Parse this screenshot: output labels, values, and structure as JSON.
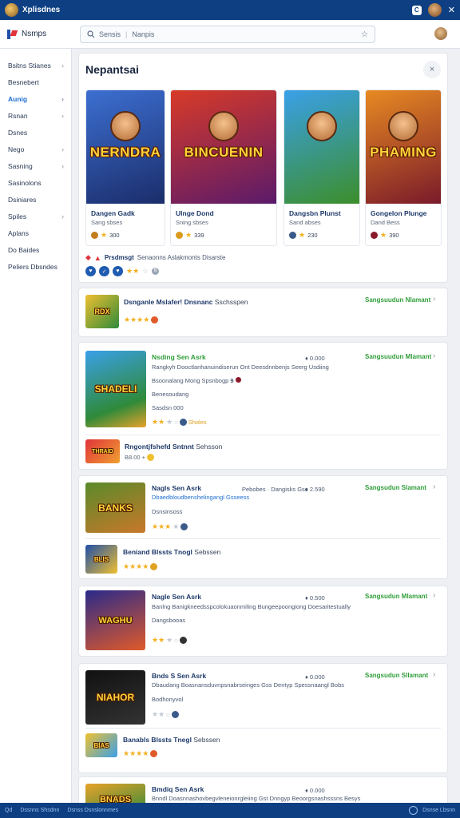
{
  "topbar": {
    "title": "Xplisdnes",
    "badge": "C",
    "close": "✕"
  },
  "header": {
    "brand": "Nsmps",
    "search_left": "Sensis",
    "search_right": "Nanpis",
    "pin": "☆"
  },
  "sidebar": {
    "items": [
      {
        "label": "Bsitns Stianes",
        "chev": true
      },
      {
        "label": "Besnebert",
        "chev": false
      },
      {
        "label": "Aunig",
        "chev": true,
        "active": true
      },
      {
        "label": "Rsnan",
        "chev": true
      },
      {
        "label": "Dsnes",
        "chev": false
      },
      {
        "label": "Nego",
        "chev": true
      },
      {
        "label": "Sasning",
        "chev": true
      },
      {
        "label": "Sasinolons",
        "chev": false
      },
      {
        "label": "Dsiniares",
        "chev": false
      },
      {
        "label": "Spiles",
        "chev": true
      },
      {
        "label": "Aplans",
        "chev": false
      },
      {
        "label": "Do Baides",
        "chev": false
      },
      {
        "label": "Peliers Dbsndes",
        "chev": false
      }
    ]
  },
  "featured": {
    "title": "Nepantsai",
    "close": "×",
    "cards": [
      {
        "art_text": "NERNDRA",
        "name": "Dangen Gadk",
        "sub": "Sang sbses",
        "rating": "300",
        "colors": [
          "#3c6fd1",
          "#1b2d6a"
        ],
        "dot": "#c47d1e"
      },
      {
        "art_text": "BINCUENIN",
        "name": "Ulnge Dond",
        "sub": "Sning sbses",
        "rating": "339",
        "colors": [
          "#d83a28",
          "#5a1a6a"
        ],
        "dot": "#d99a1e"
      },
      {
        "art_text": "",
        "name": "Dangsbn Plunst",
        "sub": "Sand abses",
        "rating": "230",
        "colors": [
          "#3aa0e8",
          "#3c8e2a"
        ],
        "dot": "#3a5a8a"
      },
      {
        "art_text": "PHAMING",
        "name": "Gongelon Plunge",
        "sub": "Dand Bess",
        "rating": "390",
        "colors": [
          "#e88a22",
          "#7a1a2a"
        ],
        "dot": "#8a1a2a"
      }
    ],
    "strip": {
      "bold": "Prsdmsgt",
      "rest": "Senaonns Aslakmonts Disarste",
      "count": "B"
    }
  },
  "list": {
    "name": "Dsnganle Mslafer! Dnsnanc",
    "rest": "Sschsspen",
    "cta": "Sangsuudun Nlamant",
    "thumb": "RDX"
  },
  "group1": {
    "name": "Nsding Sen Asrk",
    "price": "♦ 0.000",
    "cta": "Sangsuudun Mlamant",
    "desc1": "Rangkyh Dooctlanhanuindiserun Ont Deesdnnbenjs Seerg Usdiing",
    "desc2": "Bsoonalang Mong Spsnbogp",
    "desc2b": "9",
    "desc3": "Benesoudang",
    "desc4": "Sasdsn 000",
    "rating": "Sholes",
    "sub_name": "Rngontjfshefd Sntnnt",
    "sub_rest": "Sehsson",
    "sub_rating": "B8.00 +",
    "thumb": "SHADELI",
    "sub_thumb": "THRAID"
  },
  "group2": {
    "name": "Nagls Sen Asrk",
    "right_text": "Pebobes · Dangisks Gsc",
    "price": "♦ 2.590",
    "cta": "Sangsudun Slamant",
    "desc1": "Dbaedbloudbenshelingangl Gsseess",
    "desc2": "Dsnsinsoss",
    "sub_name": "Beniand Blssts Tnogl",
    "sub_rest": "Sebssen",
    "thumb": "BANKS",
    "sub_thumb": "BLIS"
  },
  "group3": {
    "name": "Nagle Sen Asrk",
    "price": "♦ 0.500",
    "cta": "Sangsudun Mlamant",
    "desc1": "Banlng Banigkneedsspcolokuaonmiling Bungeepoongiong Doesaritestually",
    "desc2": "Dangsbooas",
    "thumb": "WAGHU"
  },
  "group4": {
    "name": "Bnds S Sen Asrk",
    "price": "♦ 0.000",
    "cta": "Sangsudun Sllamant",
    "desc1": "Dbaudang Boasnansduvnpsnabrseinges Gss Dentyp Spessnaangl Bobs",
    "desc2": "Bodhonyvol",
    "sub_name": "Banabls Blssts Tnegl",
    "sub_rest": "Sebssen",
    "thumb": "NIAHOR",
    "sub_thumb": "BIAS"
  },
  "group5": {
    "name": "Bmdiq Sen Asrk",
    "price": "♦ 0.000",
    "desc1": "Bnndl Doasnnashovbegvleneionrgleiing Gst Dnngyp Beoorgsnashsssns Besys",
    "thumb": "BNADS"
  },
  "footer": {
    "left1": "Qd",
    "left2": "Dssnns Shsdnn",
    "left3": "Dsnss Dsnslonnmes",
    "right": "Dsnse Lbsnn"
  }
}
